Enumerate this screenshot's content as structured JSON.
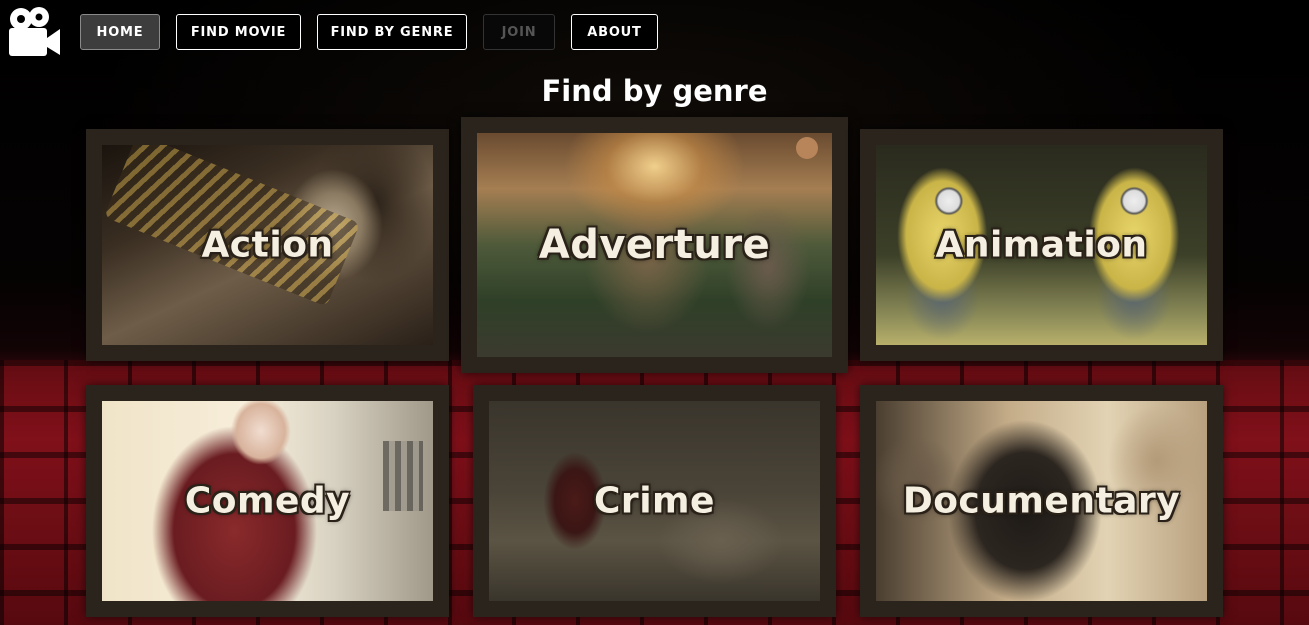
{
  "nav": {
    "logo_icon": "film-camera-icon",
    "buttons": [
      {
        "label": "HOME",
        "state": "active"
      },
      {
        "label": "FIND MOVIE",
        "state": "normal"
      },
      {
        "label": "FIND BY GENRE",
        "state": "normal"
      },
      {
        "label": "JOIN",
        "state": "disabled"
      },
      {
        "label": "ABOUT",
        "state": "normal"
      }
    ]
  },
  "page": {
    "title": "Find by genre"
  },
  "genres": [
    {
      "label": "Action"
    },
    {
      "label": "Adverture"
    },
    {
      "label": "Animation"
    },
    {
      "label": "Comedy"
    },
    {
      "label": "Crime"
    },
    {
      "label": "Documentary"
    }
  ]
}
